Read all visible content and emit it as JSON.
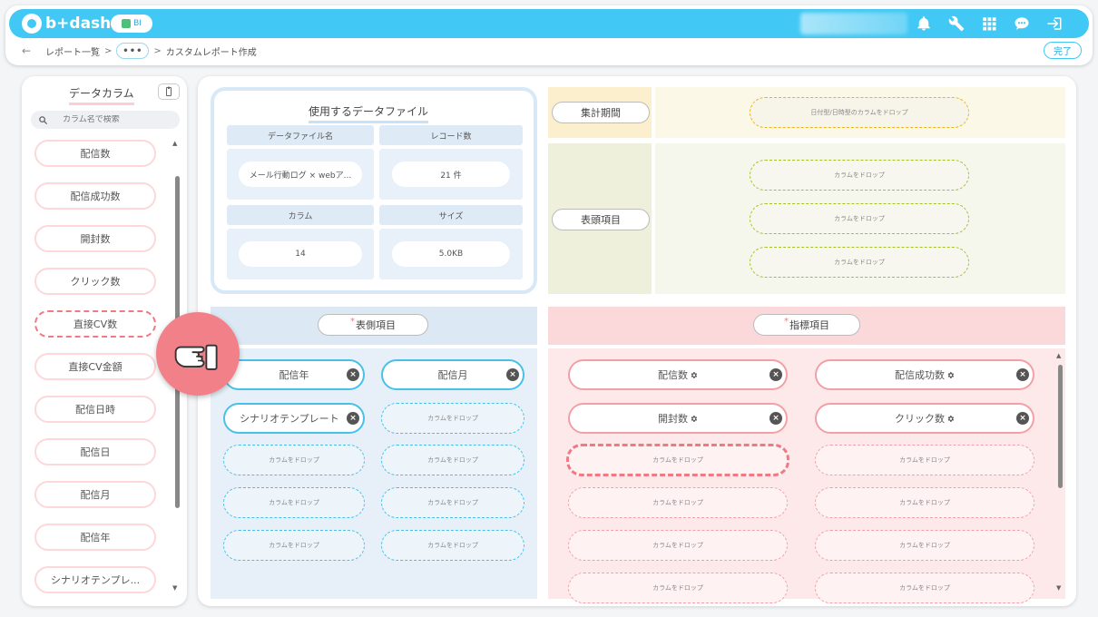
{
  "header": {
    "logo_text": "b+dash",
    "badge_label": "BI",
    "icons": [
      "bell-icon",
      "wrench-icon",
      "grid-icon",
      "chat-icon",
      "logout-icon"
    ]
  },
  "breadcrumb": {
    "back": "←",
    "item1": "レポート一覧",
    "sep": ">",
    "ellipsis": "•••",
    "current": "カスタムレポート作成"
  },
  "done_label": "完了",
  "sidebar": {
    "title": "データカラム",
    "search_placeholder": "カラム名で検索",
    "items": [
      {
        "label": "配信数"
      },
      {
        "label": "配信成功数"
      },
      {
        "label": "開封数"
      },
      {
        "label": "クリック数"
      },
      {
        "label": "直接CV数"
      },
      {
        "label": "直接CV金額"
      },
      {
        "label": "配信日時"
      },
      {
        "label": "配信日"
      },
      {
        "label": "配信月"
      },
      {
        "label": "配信年"
      },
      {
        "label": "シナリオテンプレ..."
      }
    ]
  },
  "file_card": {
    "title": "使用するデータファイル",
    "name_header": "データファイル名",
    "name_value": "メール行動ログ × webア...",
    "records_header": "レコード数",
    "records_value": "21 件",
    "columns_header": "カラム",
    "columns_value": "14",
    "size_header": "サイズ",
    "size_value": "5.0KB"
  },
  "period": {
    "label": "集計期間",
    "drop_text": "日付型/日時型のカラムをドロップ"
  },
  "row_header": {
    "label": "表頭項目",
    "drop_text": "カラムをドロップ"
  },
  "row_side": {
    "label": "表側項目",
    "required_mark": "*",
    "chips": [
      "配信年",
      "配信月",
      "シナリオテンプレート"
    ],
    "drop_text": "カラムをドロップ"
  },
  "metrics": {
    "label": "指標項目",
    "required_mark": "*",
    "chips": [
      "配信数",
      "配信成功数",
      "開封数",
      "クリック数"
    ],
    "drop_text": "カラムをドロップ"
  },
  "colors": {
    "header_blue": "#42c8f4",
    "accent_pink": "#f07a83",
    "hand_bg": "#f18089"
  }
}
